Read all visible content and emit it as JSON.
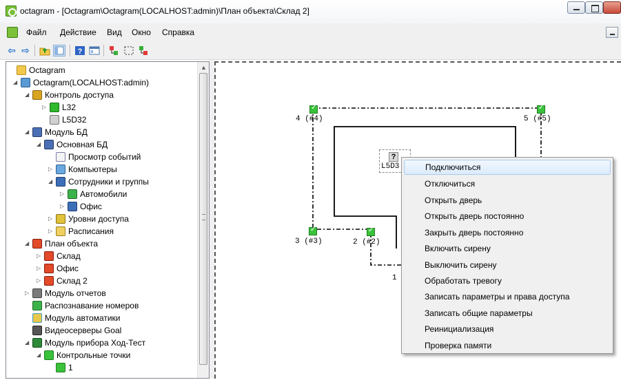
{
  "window": {
    "title": "octagram - [Octagram\\Octagram(LOCALHOST:admin)\\План объекта\\Склад 2]"
  },
  "menu": {
    "items": [
      "Файл",
      "Действие",
      "Вид",
      "Окно",
      "Справка"
    ]
  },
  "toolbar": {
    "icons": [
      "back-icon",
      "forward-icon",
      "up-folder-icon",
      "show-tree-icon",
      "help-icon",
      "properties-icon",
      "connect-icon",
      "select-icon",
      "disconnect-icon"
    ]
  },
  "tree": {
    "items": [
      {
        "label": "Octagram",
        "icon": "folder-icon"
      },
      {
        "label": "Octagram(LOCALHOST:admin)",
        "icon": "server-icon"
      },
      {
        "label": "Контроль доступа",
        "icon": "lock-icon"
      },
      {
        "label": "L32",
        "icon": "controller-icon"
      },
      {
        "label": "L5D32",
        "icon": "unknown-device-icon"
      },
      {
        "label": "Модуль БД",
        "icon": "database-icon"
      },
      {
        "label": "Основная БД",
        "icon": "database-icon"
      },
      {
        "label": "Просмотр событий",
        "icon": "events-icon"
      },
      {
        "label": "Компьютеры",
        "icon": "computers-icon"
      },
      {
        "label": "Сотрудники и группы",
        "icon": "people-icon"
      },
      {
        "label": "Автомобили",
        "icon": "car-icon"
      },
      {
        "label": "Офис",
        "icon": "people-icon"
      },
      {
        "label": "Уровни доступа",
        "icon": "keys-icon"
      },
      {
        "label": "Расписания",
        "icon": "schedule-icon"
      },
      {
        "label": "План объекта",
        "icon": "plan-icon"
      },
      {
        "label": "Склад",
        "icon": "plan-icon"
      },
      {
        "label": "Офис",
        "icon": "plan-icon"
      },
      {
        "label": "Склад 2",
        "icon": "plan-icon"
      },
      {
        "label": "Модуль отчетов",
        "icon": "report-icon"
      },
      {
        "label": "Распознавание номеров",
        "icon": "car-icon"
      },
      {
        "label": "Модуль автоматики",
        "icon": "automation-icon"
      },
      {
        "label": "Видеосерверы Goal",
        "icon": "camera-icon"
      },
      {
        "label": "Модуль прибора Ход-Тест",
        "icon": "device-module-icon"
      },
      {
        "label": "Контрольные точки",
        "icon": "checkpoint-icon"
      },
      {
        "label": "1",
        "icon": "checkpoint-icon"
      }
    ]
  },
  "canvas": {
    "device_label": "L5D3",
    "device_icon_text": "?",
    "points": [
      {
        "label": "4 (#4)"
      },
      {
        "label": "5 (#5)"
      },
      {
        "label": "3 (#3)"
      },
      {
        "label": "2 (#2)"
      },
      {
        "label": "1"
      }
    ]
  },
  "context_menu": {
    "items": [
      "Подключиться",
      "Отключиться",
      "Открыть дверь",
      "Открыть дверь постоянно",
      "Закрыть дверь постоянно",
      "Включить сирену",
      "Выключить сирену",
      "Обработать тревогу",
      "Записать параметры и права доступа",
      "Записать общие параметры",
      "Реинициализация",
      "Проверка памяти"
    ],
    "highlighted_index": 0
  },
  "colors": {
    "highlight": "#dcebfc",
    "checkpoint_green": "#3ac23a",
    "canvas_line": "#000000"
  }
}
